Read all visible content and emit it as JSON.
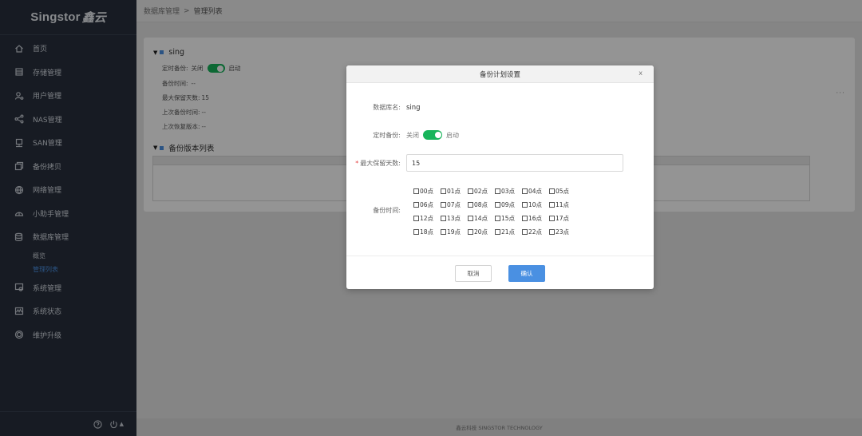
{
  "sidebar": {
    "logo_text": "Singstor",
    "logo_cn": "鑫云",
    "items": [
      {
        "label": "首页",
        "icon": "home-icon"
      },
      {
        "label": "存储管理",
        "icon": "storage-icon"
      },
      {
        "label": "用户管理",
        "icon": "users-icon"
      },
      {
        "label": "NAS管理",
        "icon": "share-icon"
      },
      {
        "label": "SAN管理",
        "icon": "server-icon"
      },
      {
        "label": "备份拷贝",
        "icon": "copy-icon"
      },
      {
        "label": "网络管理",
        "icon": "globe-icon"
      },
      {
        "label": "小助手管理",
        "icon": "helper-icon"
      },
      {
        "label": "数据库管理",
        "icon": "database-icon"
      }
    ],
    "sub_items": [
      {
        "label": "概览",
        "active": false
      },
      {
        "label": "管理列表",
        "active": true
      }
    ],
    "items_after": [
      {
        "label": "系统管理",
        "icon": "system-settings-icon"
      },
      {
        "label": "系统状态",
        "icon": "monitor-icon"
      },
      {
        "label": "维护升级",
        "icon": "upgrade-icon"
      }
    ],
    "footer": {
      "help_icon": "help-icon",
      "power_icon": "power-icon",
      "caret": "▲"
    }
  },
  "breadcrumb": {
    "parent": "数据库管理",
    "separator": ">",
    "current": "管理列表"
  },
  "db_card": {
    "name": "sing",
    "scheduled_backup_label": "定时备份:",
    "off_label": "关闭",
    "on_label": "启动",
    "backup_time_label": "备份时间:",
    "backup_time_value": "--",
    "max_days_label": "最大保留天数:",
    "max_days_value": "15",
    "last_backup_label": "上次备份时间:",
    "last_backup_value": "--",
    "last_restore_label": "上次恢复版本:",
    "last_restore_value": "--",
    "more": "···",
    "versions_title": "备份版本列表"
  },
  "footer_text": "鑫云科技 SINGSTOR TECHNOLOGY",
  "modal": {
    "title": "备份计划设置",
    "close": "x",
    "db_name_label": "数据库名:",
    "db_name_value": "sing",
    "scheduled_label": "定时备份:",
    "off_label": "关闭",
    "on_label": "启动",
    "scheduled_enabled": true,
    "required_mark": "*",
    "max_days_label": "最大保留天数:",
    "max_days_value": "15",
    "backup_time_label": "备份时间:",
    "hours": [
      "00点",
      "01点",
      "02点",
      "03点",
      "04点",
      "05点",
      "06点",
      "07点",
      "08点",
      "09点",
      "10点",
      "11点",
      "12点",
      "13点",
      "14点",
      "15点",
      "16点",
      "17点",
      "18点",
      "19点",
      "20点",
      "21点",
      "22点",
      "23点"
    ],
    "cancel_label": "取消",
    "confirm_label": "确认"
  },
  "colors": {
    "sidebar_bg": "#28303d",
    "accent": "#4a90e2",
    "toggle_on": "#17b45a",
    "required": "#e54545"
  }
}
